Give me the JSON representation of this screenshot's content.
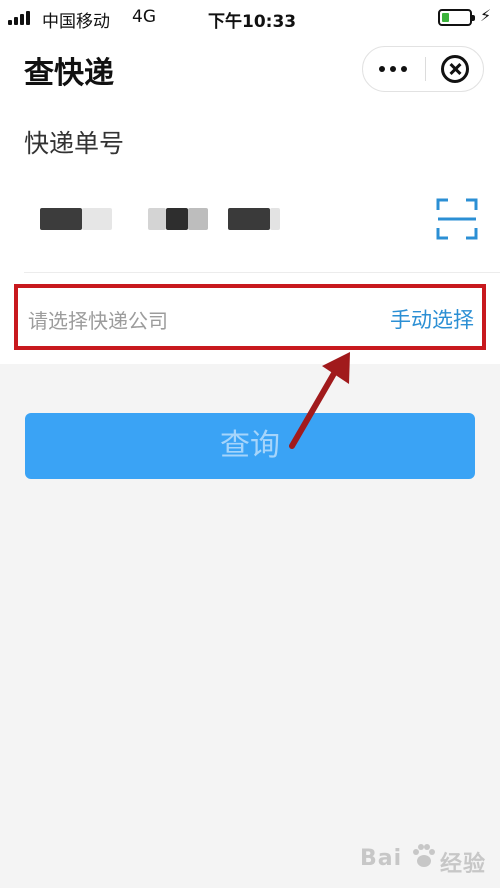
{
  "status_bar": {
    "carrier": "中国移动",
    "network": "4G",
    "time": "下午10:33",
    "battery_level": 0.25,
    "battery_color": "#3bb33b"
  },
  "header": {
    "title": "查快递",
    "more_icon": "more-dots-icon",
    "close_icon": "close-circle-icon"
  },
  "form": {
    "tracking_label": "快递单号",
    "tracking_value_state": "redacted",
    "scan_icon": "scan-icon",
    "company_placeholder": "请选择快递公司",
    "manual_select_label": "手动选择"
  },
  "search_button": {
    "label": "查询",
    "color": "#3aa3f5"
  },
  "annotation": {
    "highlight_color": "#c8191e"
  },
  "watermark": {
    "text_left": "Bai",
    "text_right": "经验"
  }
}
